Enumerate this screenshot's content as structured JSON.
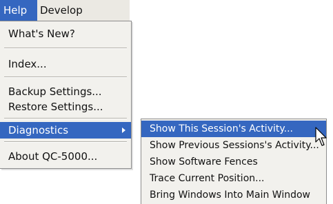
{
  "menubar": {
    "items": [
      {
        "label": "Help",
        "selected": true
      },
      {
        "label": "Develop",
        "selected": false
      }
    ]
  },
  "help_menu": {
    "items": [
      {
        "label": "What's New?"
      },
      {
        "label": "Index..."
      },
      {
        "label": "Backup Settings..."
      },
      {
        "label": "Restore Settings..."
      },
      {
        "label": "Diagnostics",
        "selected": true,
        "has_submenu": true
      },
      {
        "label": "About QC-5000..."
      }
    ]
  },
  "diagnostics_submenu": {
    "items": [
      {
        "label": "Show This Session's Activity...",
        "selected": true
      },
      {
        "label": "Show Previous Sessions's Activity..."
      },
      {
        "label": "Show Software Fences"
      },
      {
        "label": "Trace Current Position..."
      },
      {
        "label": "Bring Windows Into Main Window"
      }
    ]
  },
  "icons": {
    "submenu_arrow": "chevron-right-icon",
    "cursor": "mouse-pointer-icon"
  },
  "colors": {
    "highlight": "#3567c0",
    "menu_background": "#f2f1ed",
    "menubar_background": "#ebe9e3"
  }
}
